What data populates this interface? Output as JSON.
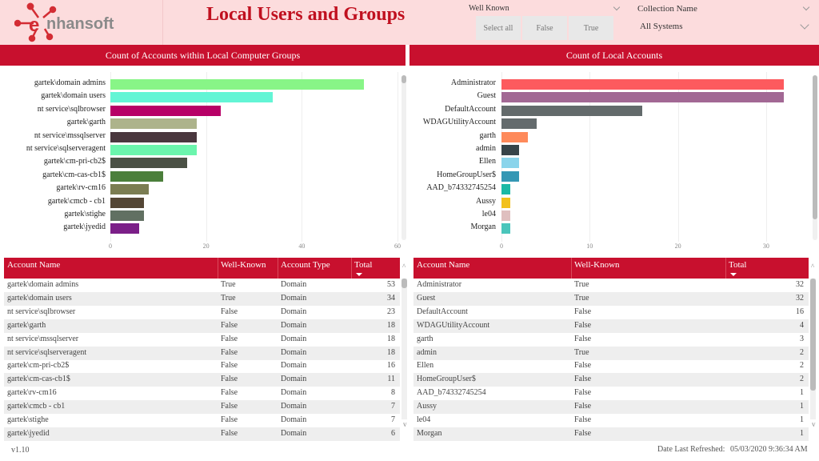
{
  "header": {
    "brand": "nhansoft",
    "title": "Local Users and Groups"
  },
  "colors": {
    "accent": "#c8102e",
    "header_bg": "#fcdcdd",
    "title": "#c0101f"
  },
  "slicers": {
    "well_known": {
      "label": "Well Known",
      "options": [
        "Select all",
        "False",
        "True"
      ]
    },
    "collection": {
      "label": "Collection Name",
      "value": "All Systems"
    }
  },
  "group_chart": {
    "title": "Count of Accounts within Local Computer Groups"
  },
  "account_chart": {
    "title": "Count of Local Accounts"
  },
  "chart_data": [
    {
      "type": "bar",
      "orientation": "horizontal",
      "title": "Count of Accounts within Local Computer Groups",
      "xlabel": "",
      "ylabel": "",
      "xlim": [
        0,
        60
      ],
      "xticks": [
        0,
        20,
        40,
        60
      ],
      "grid": true,
      "categories": [
        "gartek\\domain admins",
        "gartek\\domain users",
        "nt service\\sqlbrowser",
        "gartek\\garth",
        "nt service\\mssqlserver",
        "nt service\\sqlserveragent",
        "gartek\\cm-pri-cb2$",
        "gartek\\cm-cas-cb1$",
        "gartek\\rv-cm16",
        "gartek\\cmcb - cb1",
        "gartek\\stighe",
        "gartek\\jyedid"
      ],
      "values": [
        53,
        34,
        23,
        18,
        18,
        18,
        16,
        11,
        8,
        7,
        7,
        6
      ],
      "colors": [
        "#88f587",
        "#63f5d5",
        "#b70066",
        "#adb38b",
        "#4a373e",
        "#6bf5ad",
        "#4b5145",
        "#4b7f3b",
        "#7b7d52",
        "#544635",
        "#617062",
        "#7b1f88"
      ]
    },
    {
      "type": "bar",
      "orientation": "horizontal",
      "title": "Count of Local Accounts",
      "xlabel": "",
      "ylabel": "",
      "xlim": [
        0,
        35
      ],
      "xticks": [
        0,
        10,
        20,
        30
      ],
      "grid": true,
      "categories": [
        "Administrator",
        "Guest",
        "DefaultAccount",
        "WDAGUtilityAccount",
        "garth",
        "admin",
        "Ellen",
        "HomeGroupUser$",
        "AAD_b74332745254",
        "Aussy",
        "le04",
        "Morgan"
      ],
      "values": [
        32,
        32,
        16,
        4,
        3,
        2,
        2,
        2,
        1,
        1,
        1,
        1
      ],
      "colors": [
        "#fd5a5e",
        "#a26894",
        "#636a6b",
        "#646b6d",
        "#fe8a5b",
        "#374449",
        "#8ad4eb",
        "#3497b4",
        "#1bb9a5",
        "#f2c11c",
        "#dfbfbf",
        "#4ac5bb"
      ]
    }
  ],
  "group_table": {
    "columns": [
      "Account Name",
      "Well-Known",
      "Account Type",
      "Total"
    ],
    "rows": [
      [
        "gartek\\domain admins",
        "True",
        "Domain",
        "53"
      ],
      [
        "gartek\\domain users",
        "True",
        "Domain",
        "34"
      ],
      [
        "nt service\\sqlbrowser",
        "False",
        "Domain",
        "23"
      ],
      [
        "gartek\\garth",
        "False",
        "Domain",
        "18"
      ],
      [
        "nt service\\mssqlserver",
        "False",
        "Domain",
        "18"
      ],
      [
        "nt service\\sqlserveragent",
        "False",
        "Domain",
        "18"
      ],
      [
        "gartek\\cm-pri-cb2$",
        "False",
        "Domain",
        "16"
      ],
      [
        "gartek\\cm-cas-cb1$",
        "False",
        "Domain",
        "11"
      ],
      [
        "gartek\\rv-cm16",
        "False",
        "Domain",
        "8"
      ],
      [
        "gartek\\cmcb - cb1",
        "False",
        "Domain",
        "7"
      ],
      [
        "gartek\\stighe",
        "False",
        "Domain",
        "7"
      ],
      [
        "gartek\\jyedid",
        "False",
        "Domain",
        "6"
      ]
    ]
  },
  "account_table": {
    "columns": [
      "Account Name",
      "Well-Known",
      "Total"
    ],
    "rows": [
      [
        "Administrator",
        "True",
        "32"
      ],
      [
        "Guest",
        "True",
        "32"
      ],
      [
        "DefaultAccount",
        "False",
        "16"
      ],
      [
        "WDAGUtilityAccount",
        "False",
        "4"
      ],
      [
        "garth",
        "False",
        "3"
      ],
      [
        "admin",
        "True",
        "2"
      ],
      [
        "Ellen",
        "False",
        "2"
      ],
      [
        "HomeGroupUser$",
        "False",
        "2"
      ],
      [
        "AAD_b74332745254",
        "False",
        "1"
      ],
      [
        "Aussy",
        "False",
        "1"
      ],
      [
        "le04",
        "False",
        "1"
      ],
      [
        "Morgan",
        "False",
        "1"
      ]
    ]
  },
  "footer": {
    "version": "v1.10",
    "refreshed_label": "Date Last Refreshed:",
    "refreshed_value": "05/03/2020 9:36:34 AM"
  }
}
